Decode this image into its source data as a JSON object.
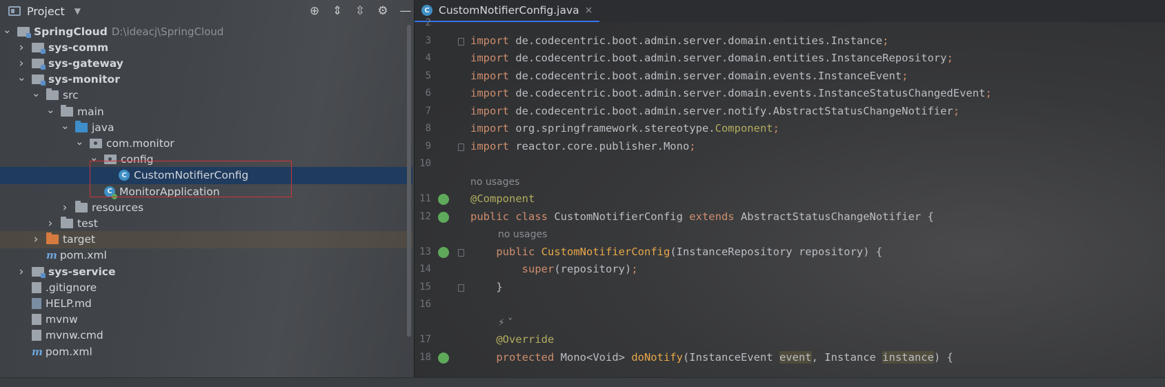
{
  "project_panel": {
    "title": "Project",
    "tree": [
      {
        "label": "SpringCloud",
        "hint": "D:\\ideacj\\SpringCloud",
        "level": 0,
        "arrow": "v",
        "icon": "module",
        "bold": true
      },
      {
        "label": "sys-comm",
        "level": 1,
        "arrow": ">",
        "icon": "module",
        "bold": true
      },
      {
        "label": "sys-gateway",
        "level": 1,
        "arrow": ">",
        "icon": "module",
        "bold": true
      },
      {
        "label": "sys-monitor",
        "level": 1,
        "arrow": "v",
        "icon": "module",
        "bold": true
      },
      {
        "label": "src",
        "level": 2,
        "arrow": "v",
        "icon": "folder"
      },
      {
        "label": "main",
        "level": 3,
        "arrow": "v",
        "icon": "folder"
      },
      {
        "label": "java",
        "level": 4,
        "arrow": "v",
        "icon": "folder-blue"
      },
      {
        "label": "com.monitor",
        "level": 5,
        "arrow": "v",
        "icon": "package"
      },
      {
        "label": "config",
        "level": 6,
        "arrow": "v",
        "icon": "package"
      },
      {
        "label": "CustomNotifierConfig",
        "level": 7,
        "arrow": "",
        "icon": "class",
        "selected": true
      },
      {
        "label": "MonitorApplication",
        "level": 6,
        "arrow": "",
        "icon": "class-app"
      },
      {
        "label": "resources",
        "level": 4,
        "arrow": ">",
        "icon": "folder"
      },
      {
        "label": "test",
        "level": 3,
        "arrow": ">",
        "icon": "folder"
      },
      {
        "label": "target",
        "level": 2,
        "arrow": ">",
        "icon": "folder-orange",
        "excluded": true
      },
      {
        "label": "pom.xml",
        "level": 2,
        "arrow": "",
        "icon": "maven"
      },
      {
        "label": "sys-service",
        "level": 1,
        "arrow": ">",
        "icon": "module",
        "bold": true
      },
      {
        "label": ".gitignore",
        "level": 1,
        "arrow": "",
        "icon": "file"
      },
      {
        "label": "HELP.md",
        "level": 1,
        "arrow": "",
        "icon": "file-md"
      },
      {
        "label": "mvnw",
        "level": 1,
        "arrow": "",
        "icon": "file"
      },
      {
        "label": "mvnw.cmd",
        "level": 1,
        "arrow": "",
        "icon": "file"
      },
      {
        "label": "pom.xml",
        "level": 1,
        "arrow": "",
        "icon": "maven"
      }
    ]
  },
  "editor": {
    "tab": {
      "label": "CustomNotifierConfig.java",
      "icon": "class",
      "close": "×"
    },
    "lines": [
      {
        "num": "2",
        "html": ""
      },
      {
        "num": "3",
        "html": "<span class='kw'>import</span> de.codecentric.boot.admin.server.domain.entities.Instance<span class='kw'>;</span>"
      },
      {
        "num": "4",
        "html": "<span class='kw'>import</span> de.codecentric.boot.admin.server.domain.entities.InstanceRepository<span class='kw'>;</span>"
      },
      {
        "num": "5",
        "html": "<span class='kw'>import</span> de.codecentric.boot.admin.server.domain.events.InstanceEvent<span class='kw'>;</span>"
      },
      {
        "num": "6",
        "html": "<span class='kw'>import</span> de.codecentric.boot.admin.server.domain.events.InstanceStatusChangedEvent<span class='kw'>;</span>"
      },
      {
        "num": "7",
        "html": "<span class='kw'>import</span> de.codecentric.boot.admin.server.notify.AbstractStatusChangeNotifier<span class='kw'>;</span>"
      },
      {
        "num": "8",
        "html": "<span class='kw'>import</span> org.springframework.stereotype.<span class='ann'>Component</span><span class='kw'>;</span>"
      },
      {
        "num": "9",
        "html": "<span class='kw'>import</span> reactor.core.publisher.Mono<span class='kw'>;</span>"
      },
      {
        "num": "10",
        "html": ""
      },
      {
        "num": "",
        "hint": "no usages"
      },
      {
        "num": "11",
        "html": "<span class='ann'>@Component</span>"
      },
      {
        "num": "12",
        "html": "<span class='kw'>public class</span> CustomNotifierConfig <span class='kw'>extends</span> AbstractStatusChangeNotifier {"
      },
      {
        "num": "",
        "hint": "no usages",
        "indent": true
      },
      {
        "num": "13",
        "html": "    <span class='kw'>public</span> <span class='ctor'>CustomNotifierConfig</span>(InstanceRepository repository) {"
      },
      {
        "num": "14",
        "html": "        <span class='sup'>super</span>(repository)<span class='kw'>;</span>"
      },
      {
        "num": "15",
        "html": "    }"
      },
      {
        "num": "16",
        "html": ""
      },
      {
        "num": "",
        "hint": "⚡ ˅",
        "indent": true
      },
      {
        "num": "17",
        "html": "    <span class='ann'>@Override</span>"
      },
      {
        "num": "18",
        "html": "    <span class='kw'>protected</span> Mono&lt;Void&gt; <span class='ctor'>doNotify</span>(InstanceEvent <span class='param-bg'>event</span>, Instance <span class='param-bg'>instance</span>) {"
      }
    ]
  }
}
